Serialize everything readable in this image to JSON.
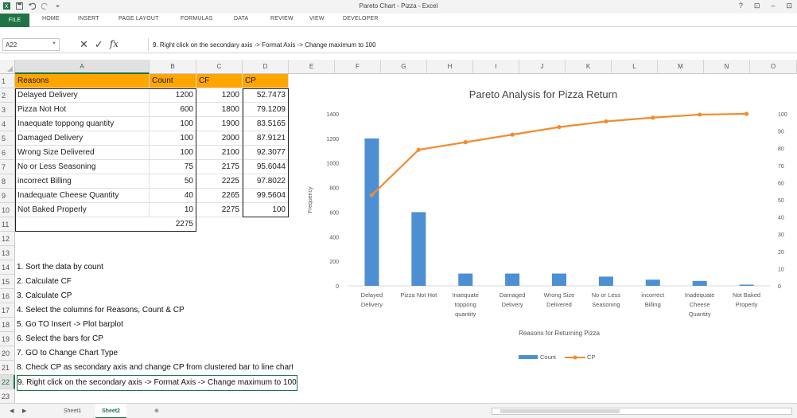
{
  "titlebar": {
    "title": "Pareto Chart - Pizza - Excel",
    "help": "?",
    "restore": "⊡",
    "minimize": "–",
    "maximize": "⊡"
  },
  "ribbon": {
    "file": "FILE",
    "tabs": [
      "HOME",
      "INSERT",
      "PAGE LAYOUT",
      "FORMULAS",
      "DATA",
      "REVIEW",
      "VIEW",
      "DEVELOPER"
    ]
  },
  "formula_bar": {
    "name_box": "A22",
    "content": "9. Right click on the secondary axis -> Format Axis -> Change maximum to 100"
  },
  "columns": [
    "A",
    "B",
    "C",
    "D",
    "E",
    "F",
    "G",
    "H",
    "I",
    "J",
    "K",
    "L",
    "M",
    "N",
    "O"
  ],
  "rows": [
    "1",
    "2",
    "3",
    "4",
    "5",
    "6",
    "7",
    "8",
    "9",
    "10",
    "11",
    "12",
    "13",
    "14",
    "15",
    "16",
    "17",
    "18",
    "19",
    "20",
    "21",
    "22",
    "23"
  ],
  "table": {
    "headers": [
      "Reasons",
      "Count",
      "CF",
      "CP"
    ],
    "rows": [
      [
        "Delayed Delivery",
        "1200",
        "1200",
        "52.7473"
      ],
      [
        "Pizza Not Hot",
        "600",
        "1800",
        "79.1209"
      ],
      [
        "Inaequate toppong quantity",
        "100",
        "1900",
        "83.5165"
      ],
      [
        "Damaged Delivery",
        "100",
        "2000",
        "87.9121"
      ],
      [
        "Wrong Size Delivered",
        "100",
        "2100",
        "92.3077"
      ],
      [
        "No or Less Seasoning",
        "75",
        "2175",
        "95.6044"
      ],
      [
        "incorrect Billing",
        "50",
        "2225",
        "97.8022"
      ],
      [
        "Inadequate Cheese Quantity",
        "40",
        "2265",
        "99.5604"
      ],
      [
        "Not Baked Properly",
        "10",
        "2275",
        "100"
      ]
    ],
    "total": "2275"
  },
  "instructions": [
    "1. Sort the data by count",
    "2. Calculate CF",
    "3. Calculate CP",
    "4. Select the columns for Reasons, Count & CP",
    "5. Go TO Insert -> Plot barplot",
    "6. Select the bars for CP",
    "7. GO to Change Chart Type",
    "8. Check CP as secondary axis and change CP from clustered bar to line chart",
    "9. Right click on the secondary axis -> Format Axis -> Change maximum to 100"
  ],
  "sheets": [
    "Sheet1",
    "Sheet2"
  ],
  "active_sheet": "Sheet2",
  "colors": {
    "accent": "#217346",
    "header_fill": "#FFA500",
    "bar": "#4E8FD4",
    "line": "#F08C2E"
  },
  "chart_data": {
    "type": "bar",
    "title": "Pareto Analysis for Pizza Return",
    "xlabel": "Reasons for Returning Pizza",
    "ylabel": "Frequency",
    "categories": [
      "Delayed Delivery",
      "Pizza Not Hot",
      "Inaequate toppong quantity",
      "Damaged Delivery",
      "Wrong Size Delivered",
      "No or Less Seasoning",
      "incorrect Billing",
      "Inadequate Cheese Quantity",
      "Not Baked Properly"
    ],
    "category_labels": [
      [
        "Delayed",
        "Delivery"
      ],
      [
        "Pizza Not Hot"
      ],
      [
        "Inaequate",
        "toppong",
        "quantity"
      ],
      [
        "Damaged",
        "Delivery"
      ],
      [
        "Wrong Size",
        "Delivered"
      ],
      [
        "No or Less",
        "Seasoning"
      ],
      [
        "incorrect",
        "Billing"
      ],
      [
        "Inadequate",
        "Cheese",
        "Quantity"
      ],
      [
        "Not Baked",
        "Properly"
      ]
    ],
    "series": [
      {
        "name": "Count",
        "type": "bar",
        "axis": "primary",
        "values": [
          1200,
          600,
          100,
          100,
          100,
          75,
          50,
          40,
          10
        ]
      },
      {
        "name": "CP",
        "type": "line",
        "axis": "secondary",
        "values": [
          52.7473,
          79.1209,
          83.5165,
          87.9121,
          92.3077,
          95.6044,
          97.8022,
          99.5604,
          100
        ]
      }
    ],
    "ylim": [
      0,
      1400
    ],
    "y_ticks": [
      "0",
      "200",
      "400",
      "600",
      "800",
      "1000",
      "1200",
      "1400"
    ],
    "y2lim": [
      0,
      100
    ],
    "y2_ticks": [
      "0",
      "10",
      "20",
      "30",
      "40",
      "50",
      "60",
      "70",
      "80",
      "90",
      "100"
    ],
    "legend": "bottom",
    "grid": false
  }
}
